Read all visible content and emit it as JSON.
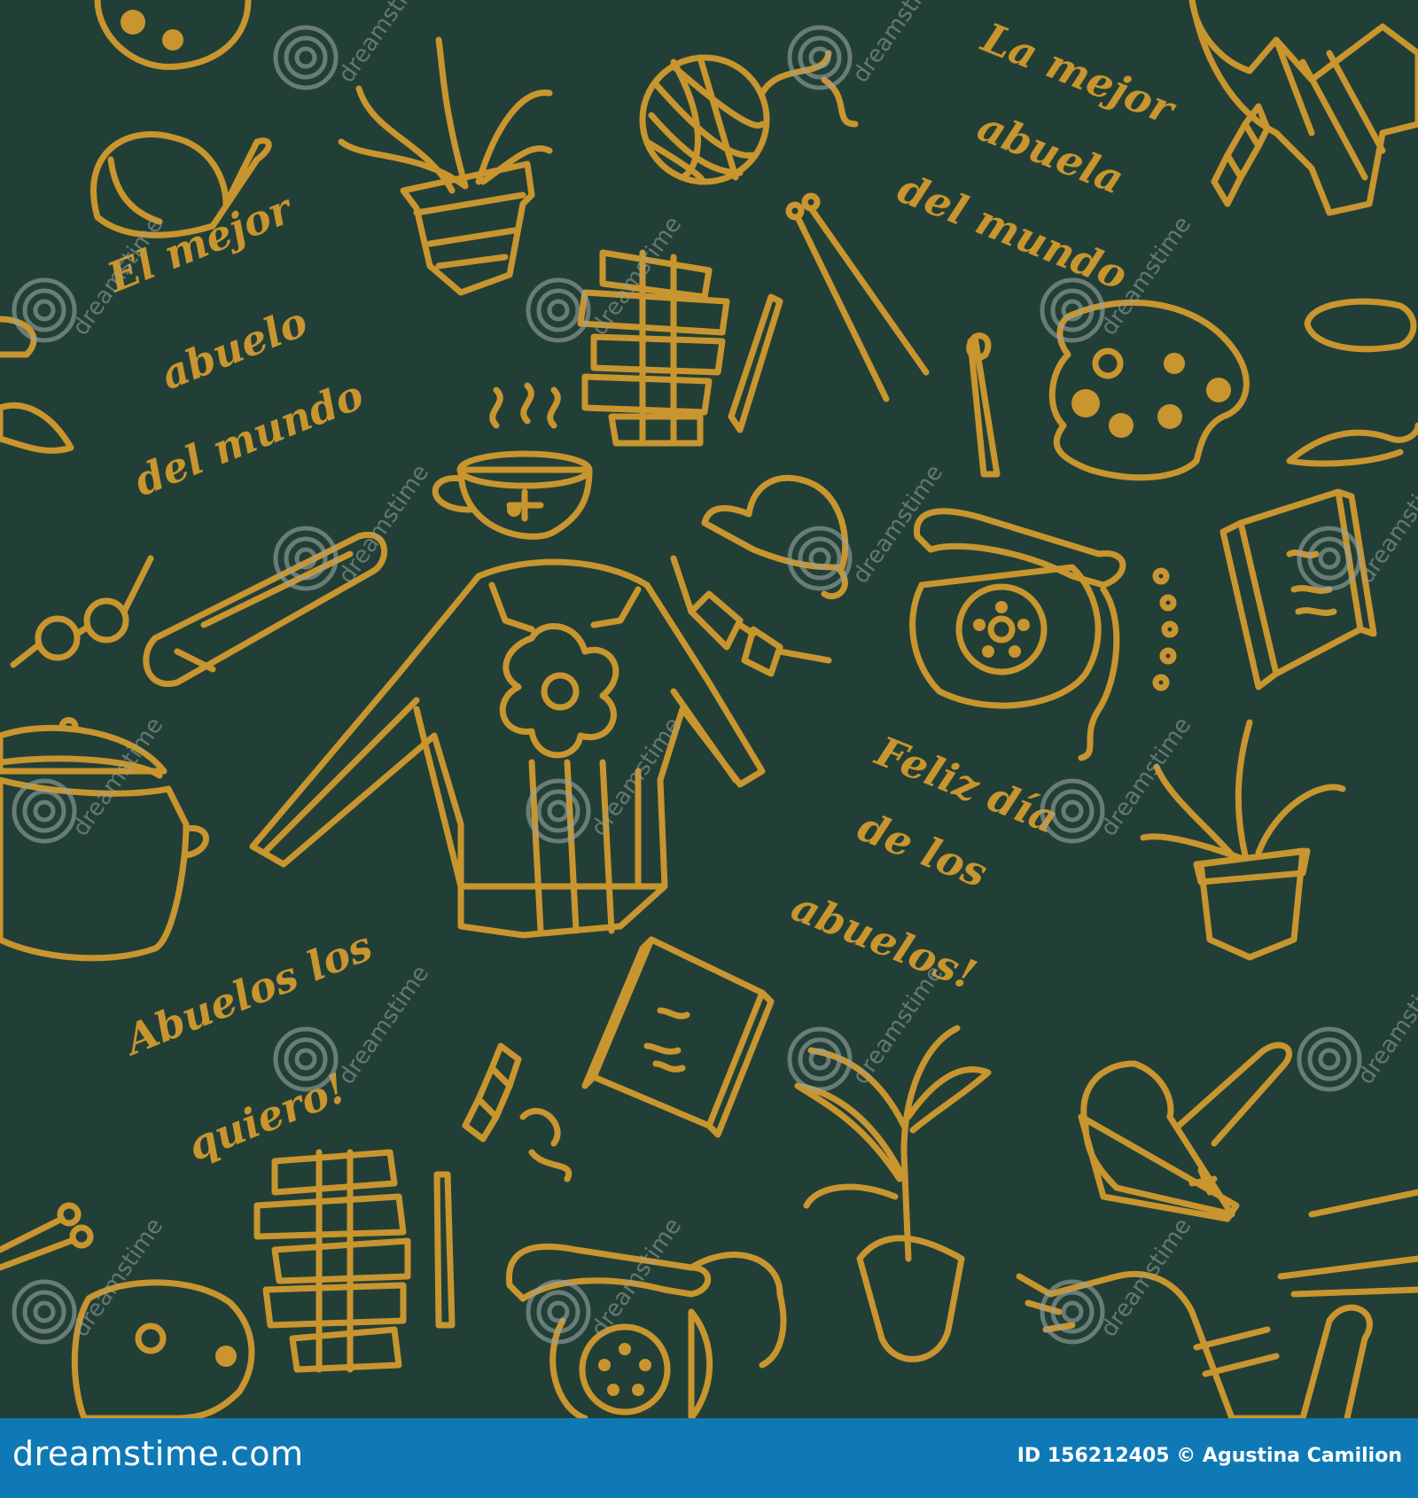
{
  "colors": {
    "background": "#223f37",
    "ink": "#c9952e",
    "footer": "#0f79b6",
    "watermark": "#9aa5a0"
  },
  "texts": {
    "abuelo": [
      "El mejor",
      "abuelo",
      "del mundo"
    ],
    "abuela": [
      "La mejor",
      "abuela",
      "del mundo"
    ],
    "feliz": [
      "Feliz día",
      "de los",
      "abuelos!"
    ],
    "quiero": [
      "Abuelos los",
      "quiero!"
    ]
  },
  "watermark": {
    "text": "dreamstime"
  },
  "footer": {
    "brand": "dreamstime.com",
    "credit": "ID 156212405 © Agustina Camilion"
  },
  "icons": [
    "sweater-icon",
    "cup-icon",
    "yarn-ball-icon",
    "plant-pot-icon",
    "hat-icon",
    "telephone-icon",
    "palette-icon",
    "book-icon",
    "watering-can-icon",
    "scarf-icon",
    "glasses-icon",
    "knitting-needles-icon",
    "cooking-pot-icon",
    "candy-icon",
    "pencil-icon",
    "brush-icon",
    "sprout-icon",
    "jenga-tower-icon",
    "mustache-icon",
    "rolling-pin-icon"
  ]
}
